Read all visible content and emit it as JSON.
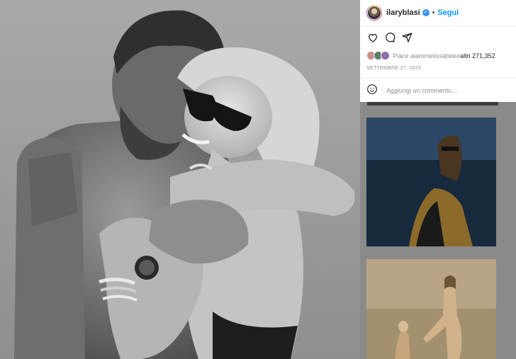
{
  "post": {
    "username": "ilaryblasi",
    "separator": "•",
    "follow_label": "Segui",
    "verified_glyph": "✓",
    "avatar_icon": "profile-avatar-icon"
  },
  "actions": {
    "like_icon": "heart-icon",
    "comment_icon": "comment-icon",
    "share_icon": "share-icon"
  },
  "likes": {
    "prefix": "Piace a ",
    "user": "iammelissabee",
    "middle": " e ",
    "others": "altri 271,352"
  },
  "date": "SETTEMBRE 27, 2020",
  "comment": {
    "placeholder": "Aggiungi un commento...",
    "emoji_icon": "emoji-icon"
  },
  "colors": {
    "accent": "#0095f6",
    "verified": "#3897f0",
    "text": "#262626",
    "muted": "#8e8e8e"
  }
}
